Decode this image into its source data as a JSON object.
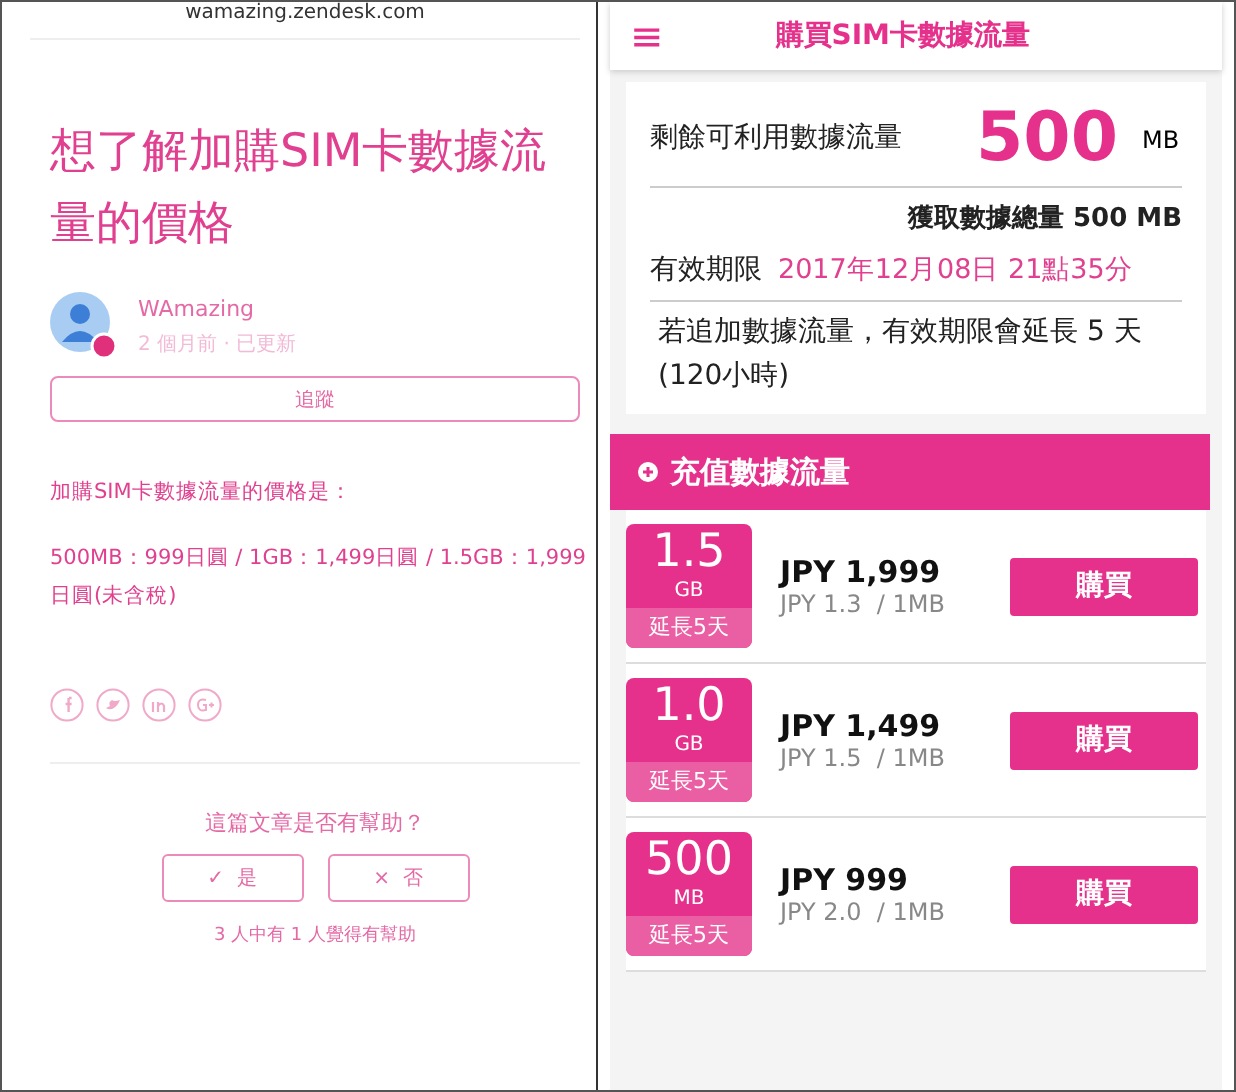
{
  "left": {
    "url": "wamazing.zendesk.com",
    "title": "想了解加購SIM卡數據流量的價格",
    "author": "WAmazing",
    "meta": "2 個月前 · 已更新",
    "follow_button": "追蹤",
    "intro": "加購SIM卡數據流量的價格是：",
    "prices": "500MB：999日圓 / 1GB：1,499日圓 / 1.5GB：1,999日圓(未含稅)",
    "feedback_question": "這篇文章是否有幫助？",
    "feedback_buttons": [
      {
        "icon": "✓",
        "label": "是"
      },
      {
        "icon": "×",
        "label": "否"
      }
    ],
    "feedback_count": "3 人中有 1 人覺得有幫助"
  },
  "right": {
    "menu_icon": "≡",
    "title": "購買SIM卡數據流量",
    "remaining_label": "剩餘可利用數據流量",
    "remaining_value": "500",
    "remaining_unit": "MB",
    "total": "獲取數據總量 500 MB",
    "expiry_label": "有效期限",
    "expiry_value": "2017年12月08日 21點35分",
    "note": "若追加數據流量，有效期限會延長 5 天(120小時)",
    "section_title": "充值數據流量",
    "plans": [
      {
        "size": "1.5",
        "unit": "GB",
        "extend": "延長5天",
        "price": "JPY 1,999",
        "unit_price": "JPY 1.3  / 1MB",
        "button": "購買"
      },
      {
        "size": "1.0",
        "unit": "GB",
        "extend": "延長5天",
        "price": "JPY 1,499",
        "unit_price": "JPY 1.5  / 1MB",
        "button": "購買"
      },
      {
        "size": "500",
        "unit": "MB",
        "extend": "延長5天",
        "price": "JPY 999",
        "unit_price": "JPY 2.0  / 1MB",
        "button": "購買"
      }
    ]
  }
}
